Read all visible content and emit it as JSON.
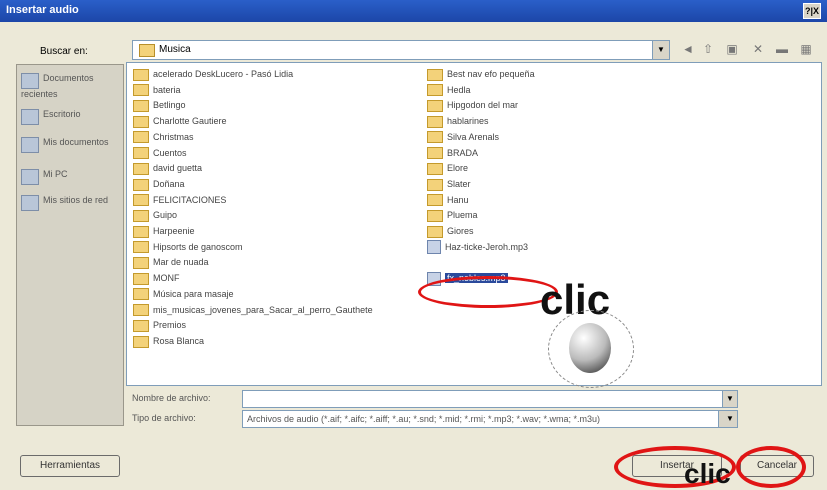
{
  "window": {
    "title": "Insertar audio",
    "help_label": "?|X"
  },
  "toolbar": {
    "lookin_label": "Buscar en:",
    "lookin_value": "Musica",
    "back_icon": "back-icon",
    "up_icon": "up-folder-icon",
    "new_folder_icon": "new-folder-icon",
    "delete_icon": "delete-icon",
    "views_icon": "views-icon"
  },
  "places": [
    {
      "label": "Documentos recientes"
    },
    {
      "label": "Escritorio"
    },
    {
      "label": "Mis documentos"
    },
    {
      "label": "Mi PC"
    },
    {
      "label": "Mis sitios de red"
    }
  ],
  "files": {
    "col1": [
      "acelerado DeskLucero - Pasó Lidia",
      "bateria",
      "Betlingo",
      "Charlotte Gautiere",
      "Christmas",
      "Cuentos",
      "david guetta",
      "Doñana",
      "FELICITACIONES",
      "Guipo",
      "Harpeenie",
      "Hipsorts de ganoscom",
      "Mar de nuada",
      "MONF",
      "Música para masaje",
      "mis_musicas_jovenes_para_Sacar_al_perro_Gauthete",
      "Premios",
      "Rosa Blanca"
    ],
    "col2": [
      "Best nav efo pequeña",
      "Hedla",
      "Hipgodon del mar",
      "hablarines",
      "Silva Arenals",
      "BRADA",
      "Elore",
      "Slater",
      "Hanu",
      "Pluema",
      "Giores",
      "Haz-ticke-Jeroh.mp3",
      "fx_nobles.mp3"
    ],
    "selected_index_col2": 12
  },
  "annotations": {
    "clic_top": "clic",
    "clic_bottom": "clic"
  },
  "form": {
    "filename_label": "Nombre de archivo:",
    "filename_value": "",
    "filetype_label": "Tipo de archivo:",
    "filetype_value": "Archivos de audio (*.aif; *.aifc; *.aiff; *.au; *.snd; *.mid; *.rmi; *.mp3; *.wav; *.wma; *.m3u)"
  },
  "buttons": {
    "tools": "Herramientas",
    "open": "Insertar",
    "cancel": "Cancelar"
  },
  "colors": {
    "titlebar": "#2a5fc9",
    "selection": "#2a4a9c",
    "annotation_red": "#e01515"
  }
}
